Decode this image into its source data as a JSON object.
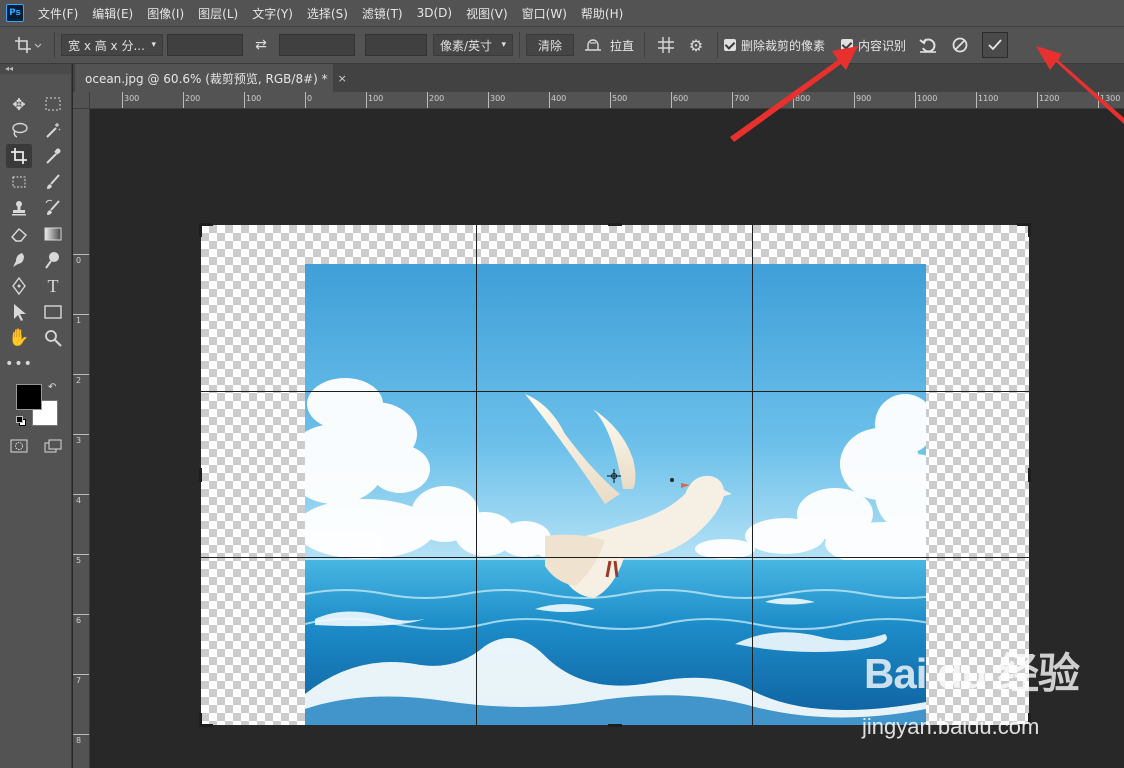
{
  "app": {
    "logo": "Ps",
    "accent": "#31a8ff"
  },
  "menu": [
    "文件(F)",
    "编辑(E)",
    "图像(I)",
    "图层(L)",
    "文字(Y)",
    "选择(S)",
    "滤镜(T)",
    "3D(D)",
    "视图(V)",
    "窗口(W)",
    "帮助(H)"
  ],
  "options": {
    "ratio_dropdown": "宽 x 高 x 分...",
    "unit_dropdown": "像素/英寸",
    "clear_label": "清除",
    "straighten_label": "拉直",
    "delete_cropped_label": "删除裁剪的像素",
    "delete_cropped_checked": true,
    "content_aware_label": "内容识别",
    "content_aware_checked": true
  },
  "document": {
    "tab_title": "ocean.jpg @ 60.6% (裁剪预览, RGB/8#) *",
    "close_glyph": "×"
  },
  "ruler_h": [
    "300",
    "200",
    "100",
    "0",
    "100",
    "200",
    "300",
    "400",
    "500",
    "600",
    "700",
    "800",
    "900",
    "1000",
    "1100",
    "1200",
    "1300"
  ],
  "ruler_v": [
    "0",
    "1",
    "2",
    "3",
    "4",
    "5",
    "6",
    "7",
    "8"
  ],
  "tools": [
    "move-icon",
    "marquee-icon",
    "lasso-icon",
    "magic-wand-icon",
    "crop-icon",
    "eyedropper-icon",
    "frame-icon",
    "brush-icon",
    "stamp-icon",
    "history-brush-icon",
    "eraser-icon",
    "gradient-icon",
    "smudge-icon",
    "dodge-icon",
    "pen-icon",
    "type-icon",
    "path-select-icon",
    "rectangle-icon",
    "hand-icon",
    "zoom-icon",
    "more-icon"
  ],
  "colors": {
    "foreground": "#000000",
    "background": "#ffffff",
    "annotation_arrow": "#e8312f"
  },
  "watermark": {
    "logo": "Bai du 经验",
    "url": "jingyan.baidu.com"
  }
}
